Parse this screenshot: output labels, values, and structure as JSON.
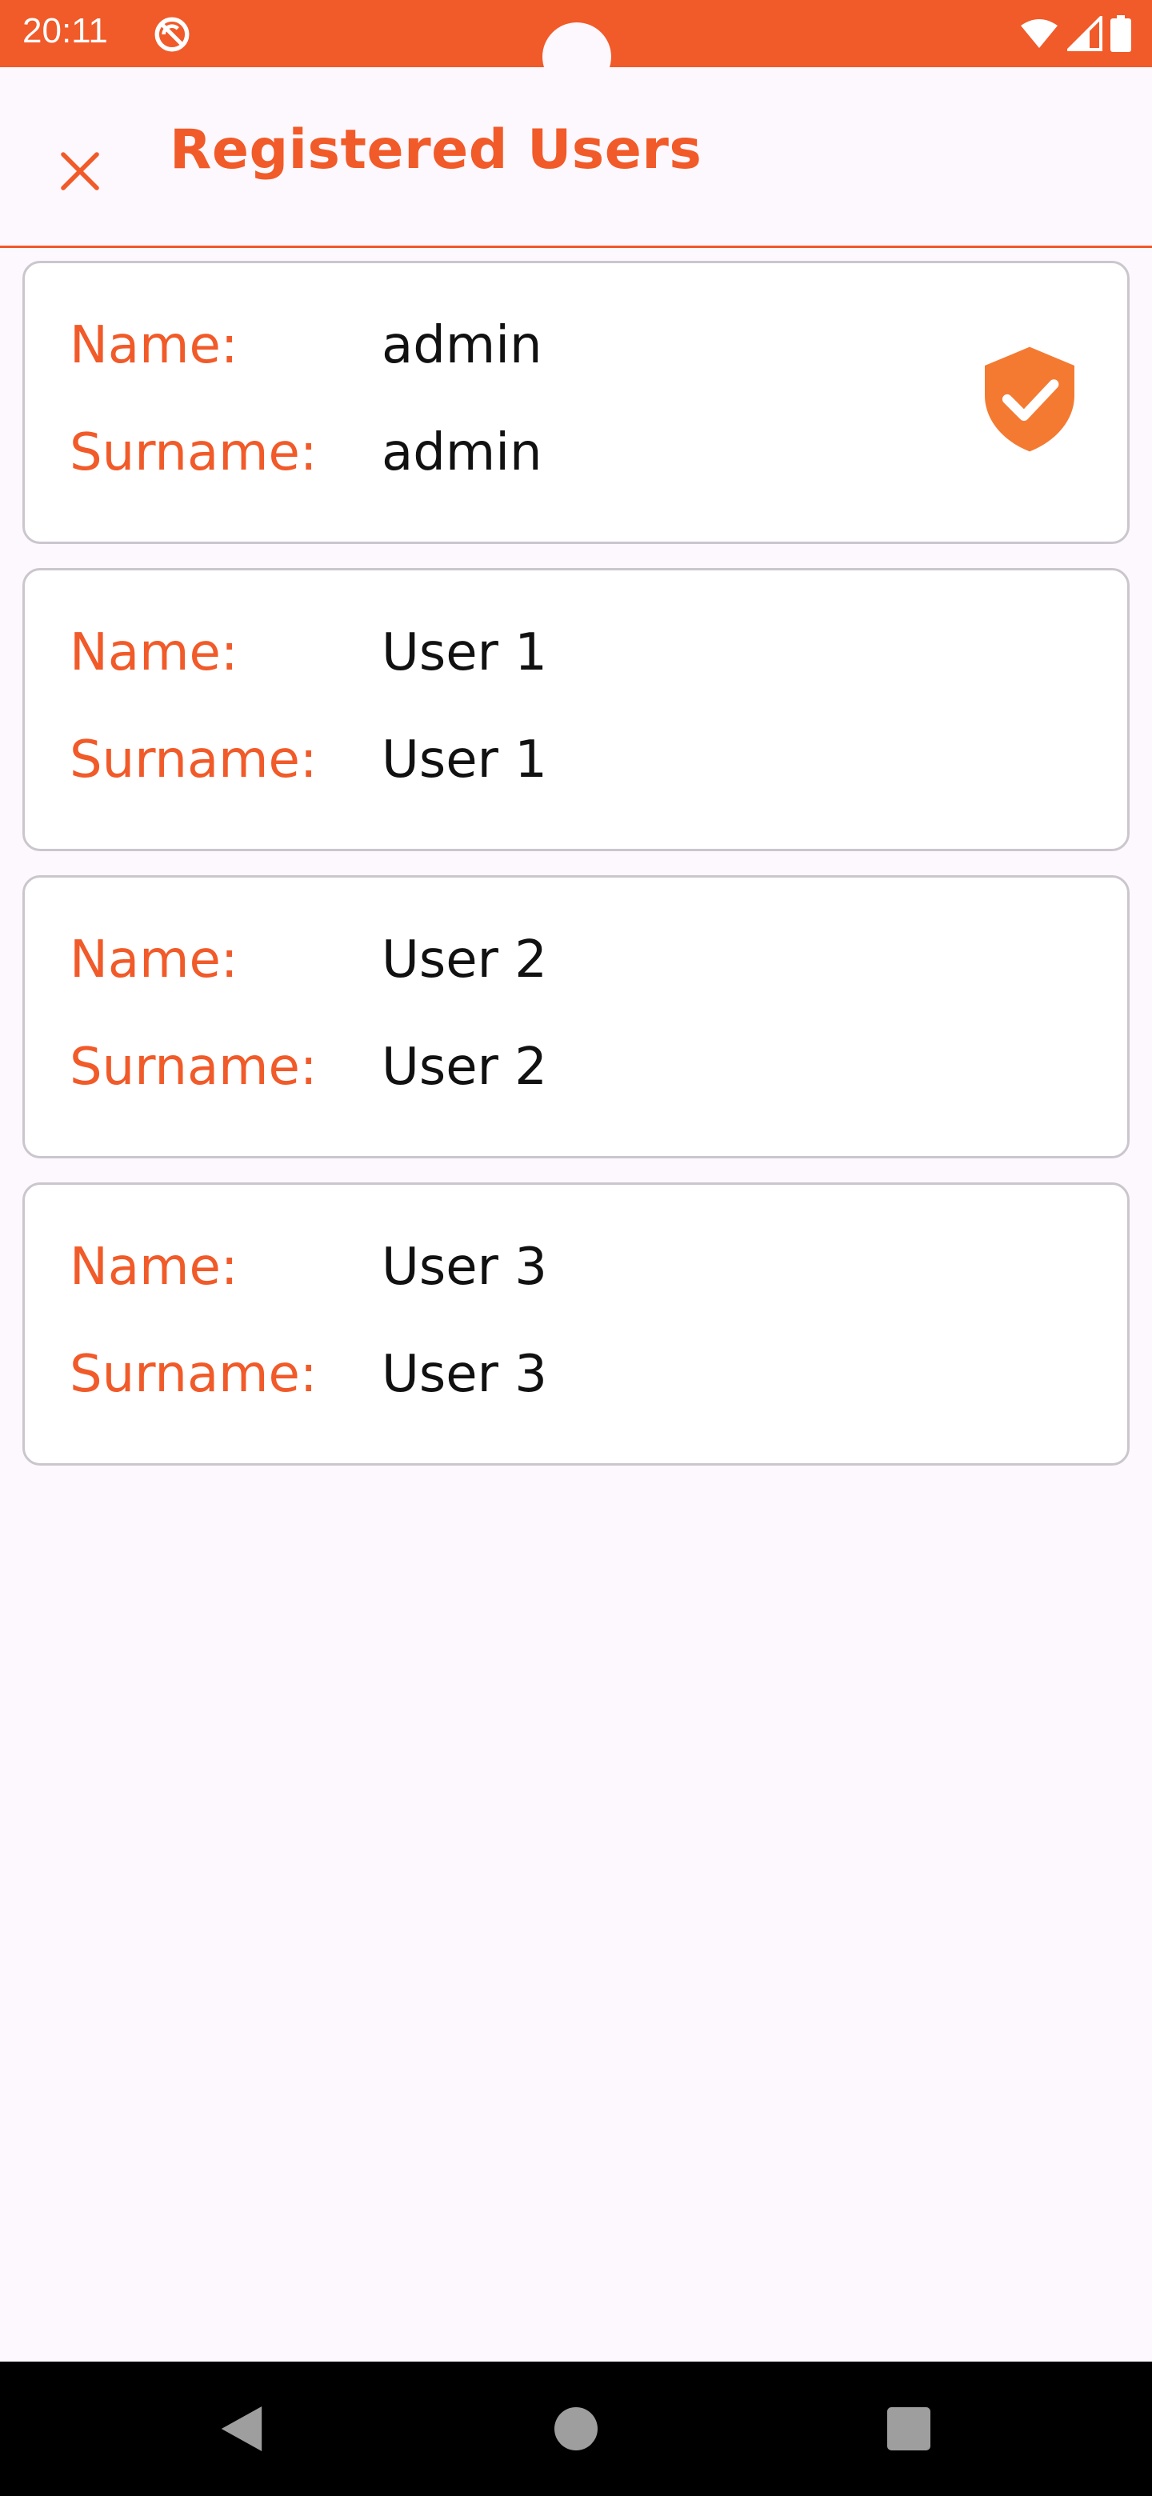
{
  "status_bar": {
    "time": "20:11",
    "icons": [
      "sync-disabled-icon",
      "wifi-icon",
      "signal-icon",
      "battery-icon"
    ]
  },
  "header": {
    "title": "Registered Users",
    "close_icon": "close-icon"
  },
  "users": [
    {
      "name_label": "Name:",
      "name": "admin",
      "surname_label": "Surname:",
      "surname": "admin",
      "is_admin": true
    },
    {
      "name_label": "Name:",
      "name": "User 1",
      "surname_label": "Surname:",
      "surname": "User 1",
      "is_admin": false
    },
    {
      "name_label": "Name:",
      "name": "User 2",
      "surname_label": "Surname:",
      "surname": "User 2",
      "is_admin": false
    },
    {
      "name_label": "Name:",
      "name": "User 3",
      "surname_label": "Surname:",
      "surname": "User 3",
      "is_admin": false
    }
  ],
  "nav": {
    "back_icon": "back-icon",
    "home_icon": "home-icon",
    "recents_icon": "recents-icon"
  },
  "colors": {
    "accent": "#F15A29",
    "badge": "#F47A32",
    "card_border": "#CBC6CD",
    "background": "#FDF8FD"
  }
}
